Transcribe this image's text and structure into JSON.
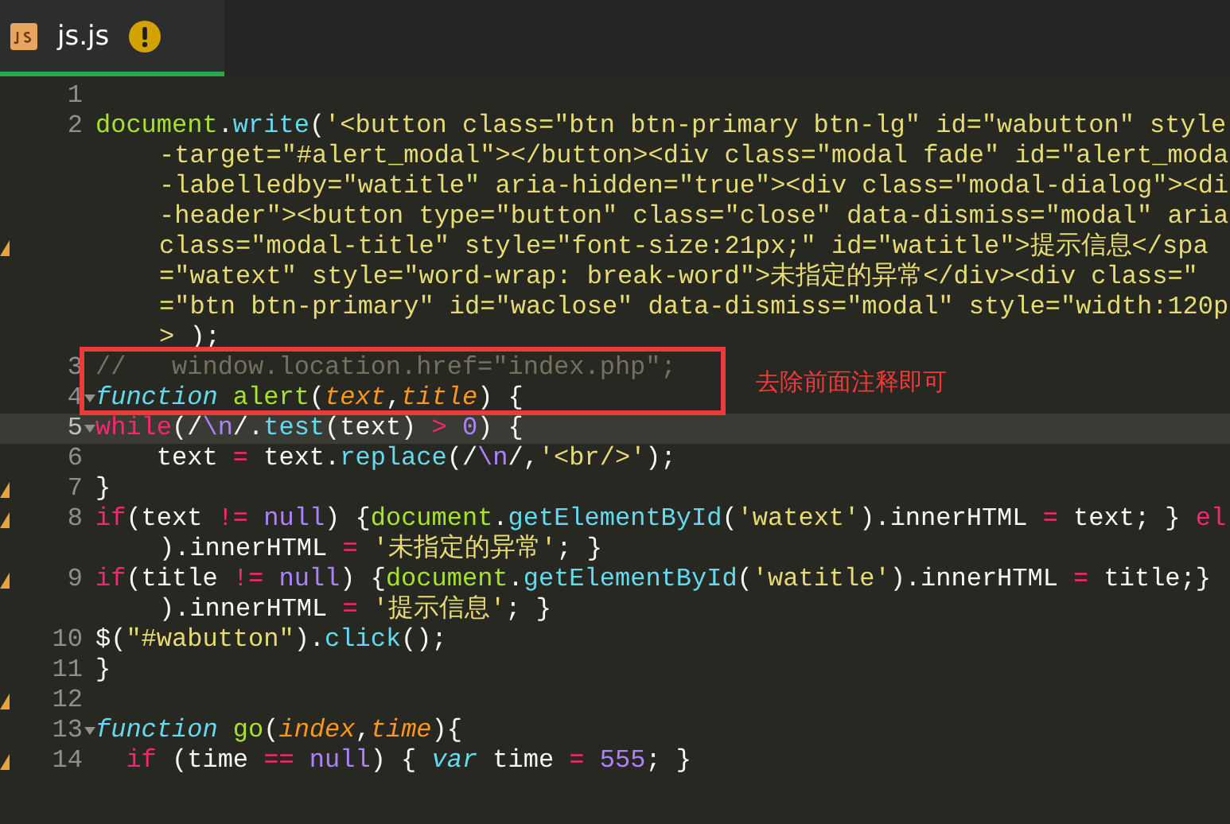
{
  "tabs": [
    {
      "label": "js.js",
      "selected": true,
      "warning": true
    }
  ],
  "rows": [
    {
      "num": "1"
    },
    {
      "num": "2",
      "segs": [
        {
          "kind": "obj",
          "t": "document"
        },
        {
          "kind": "plain",
          "t": "."
        },
        {
          "kind": "call",
          "t": "write"
        },
        {
          "kind": "plain",
          "t": "("
        },
        {
          "kind": "str",
          "t": "'<button class=\"btn btn-primary btn-lg\" id=\"wabutton\" style"
        }
      ]
    },
    {
      "segs": [
        {
          "kind": "str",
          "t": "-target=\"#alert_modal\"></button><div class=\"modal fade\" id=\"alert_moda"
        }
      ]
    },
    {
      "segs": [
        {
          "kind": "str",
          "t": "-labelledby=\"watitle\" aria-hidden=\"true\"><div class=\"modal-dialog\"><di"
        }
      ]
    },
    {
      "segs": [
        {
          "kind": "str",
          "t": "-header\"><button type=\"button\" class=\"close\" data-dismiss=\"modal\" aria"
        }
      ]
    },
    {
      "warn": true,
      "segs": [
        {
          "kind": "str",
          "t": "class=\"modal-title\" style=\"font-size:21px;\" id=\"watitle\">提示信息</spa"
        }
      ]
    },
    {
      "segs": [
        {
          "kind": "str",
          "t": "=\"watext\" style=\"word-wrap: break-word\">未指定的异常</div><div class=\""
        }
      ]
    },
    {
      "segs": [
        {
          "kind": "str",
          "t": "=\"btn btn-primary\" id=\"waclose\" data-dismiss=\"modal\" style=\"width:120p"
        }
      ]
    },
    {
      "segs": [
        {
          "kind": "str",
          "t": ">"
        },
        {
          "kind": "plain",
          "t": " );"
        }
      ]
    },
    {
      "num": "3",
      "segs": [
        {
          "kind": "comment",
          "t": "//   window.location.href=\"index.php\";"
        }
      ]
    },
    {
      "num": "4",
      "fold": true,
      "segs": [
        {
          "kind": "storage",
          "t": "function"
        },
        {
          "kind": "obj",
          "t": " alert"
        },
        {
          "kind": "plain",
          "t": "("
        },
        {
          "kind": "param",
          "t": "text"
        },
        {
          "kind": "plain",
          "t": ","
        },
        {
          "kind": "param",
          "t": "title"
        },
        {
          "kind": "plain",
          "t": ") {"
        }
      ]
    },
    {
      "num": "5",
      "fold": true,
      "current": true,
      "segs": [
        {
          "kind": "kw",
          "t": "while"
        },
        {
          "kind": "plain",
          "t": "(/"
        },
        {
          "kind": "num",
          "t": "\\n"
        },
        {
          "kind": "plain",
          "t": "/."
        },
        {
          "kind": "call",
          "t": "test"
        },
        {
          "kind": "plain",
          "t": "(text)"
        },
        {
          "kind": "kw",
          "t": " >"
        },
        {
          "kind": "num",
          "t": " 0"
        },
        {
          "kind": "plain",
          "t": ") {"
        }
      ]
    },
    {
      "num": "6",
      "segs": [
        {
          "kind": "plain",
          "t": "    text"
        },
        {
          "kind": "kw",
          "t": " ="
        },
        {
          "kind": "plain",
          "t": " text."
        },
        {
          "kind": "call",
          "t": "replace"
        },
        {
          "kind": "plain",
          "t": "(/"
        },
        {
          "kind": "num",
          "t": "\\n"
        },
        {
          "kind": "plain",
          "t": "/,"
        },
        {
          "kind": "str",
          "t": "'<br/>'"
        },
        {
          "kind": "plain",
          "t": ");"
        }
      ]
    },
    {
      "num": "7",
      "warn": true,
      "segs": [
        {
          "kind": "plain",
          "t": "}"
        }
      ]
    },
    {
      "num": "8",
      "warn": true,
      "segs": [
        {
          "kind": "kw",
          "t": "if"
        },
        {
          "kind": "plain",
          "t": "(text"
        },
        {
          "kind": "kw",
          "t": " !="
        },
        {
          "kind": "num",
          "t": " null"
        },
        {
          "kind": "plain",
          "t": ") {"
        },
        {
          "kind": "obj",
          "t": "document"
        },
        {
          "kind": "plain",
          "t": "."
        },
        {
          "kind": "call",
          "t": "getElementById"
        },
        {
          "kind": "plain",
          "t": "("
        },
        {
          "kind": "str",
          "t": "'watext'"
        },
        {
          "kind": "plain",
          "t": ").innerHTML"
        },
        {
          "kind": "kw",
          "t": " ="
        },
        {
          "kind": "plain",
          "t": " text; }"
        },
        {
          "kind": "kw",
          "t": " el"
        }
      ]
    },
    {
      "segs": [
        {
          "kind": "plain",
          "t": ").innerHTML"
        },
        {
          "kind": "kw",
          "t": " ="
        },
        {
          "kind": "str",
          "t": " '未指定的异常'"
        },
        {
          "kind": "plain",
          "t": "; }"
        }
      ]
    },
    {
      "num": "9",
      "warn": true,
      "segs": [
        {
          "kind": "kw",
          "t": "if"
        },
        {
          "kind": "plain",
          "t": "(title"
        },
        {
          "kind": "kw",
          "t": " !="
        },
        {
          "kind": "num",
          "t": " null"
        },
        {
          "kind": "plain",
          "t": ") {"
        },
        {
          "kind": "obj",
          "t": "document"
        },
        {
          "kind": "plain",
          "t": "."
        },
        {
          "kind": "call",
          "t": "getElementById"
        },
        {
          "kind": "plain",
          "t": "("
        },
        {
          "kind": "str",
          "t": "'watitle'"
        },
        {
          "kind": "plain",
          "t": ").innerHTML"
        },
        {
          "kind": "kw",
          "t": " ="
        },
        {
          "kind": "plain",
          "t": " title;}"
        }
      ]
    },
    {
      "segs": [
        {
          "kind": "plain",
          "t": ").innerHTML"
        },
        {
          "kind": "kw",
          "t": " ="
        },
        {
          "kind": "str",
          "t": " '提示信息'"
        },
        {
          "kind": "plain",
          "t": "; }"
        }
      ]
    },
    {
      "num": "10",
      "segs": [
        {
          "kind": "plain",
          "t": "$("
        },
        {
          "kind": "str",
          "t": "\"#wabutton\""
        },
        {
          "kind": "plain",
          "t": ")."
        },
        {
          "kind": "call",
          "t": "click"
        },
        {
          "kind": "plain",
          "t": "();"
        }
      ]
    },
    {
      "num": "11",
      "segs": [
        {
          "kind": "plain",
          "t": "}"
        }
      ]
    },
    {
      "num": "12",
      "warn": true
    },
    {
      "num": "13",
      "fold": true,
      "segs": [
        {
          "kind": "storage",
          "t": "function"
        },
        {
          "kind": "obj",
          "t": " go"
        },
        {
          "kind": "plain",
          "t": "("
        },
        {
          "kind": "param",
          "t": "index"
        },
        {
          "kind": "plain",
          "t": ","
        },
        {
          "kind": "param",
          "t": "time"
        },
        {
          "kind": "plain",
          "t": "){"
        }
      ]
    },
    {
      "num": "14",
      "warn": true,
      "segs": [
        {
          "kind": "kw",
          "t": "  if"
        },
        {
          "kind": "plain",
          "t": " (time"
        },
        {
          "kind": "kw",
          "t": " =="
        },
        {
          "kind": "num",
          "t": " null"
        },
        {
          "kind": "plain",
          "t": ") {"
        },
        {
          "kind": "storage",
          "t": " var"
        },
        {
          "kind": "plain",
          "t": " time"
        },
        {
          "kind": "kw",
          "t": " ="
        },
        {
          "kind": "num",
          "t": " 555"
        },
        {
          "kind": "plain",
          "t": "; }"
        }
      ]
    }
  ],
  "annotation": {
    "text": "去除前面注释即可"
  }
}
